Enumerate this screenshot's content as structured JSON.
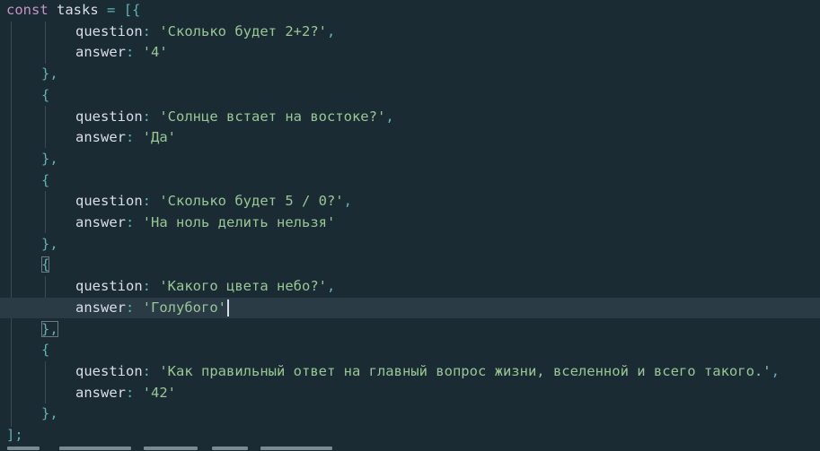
{
  "code": {
    "keyword": "const",
    "var_name": "tasks",
    "assign": "=",
    "open": "[{",
    "close": "];",
    "question_key": "question",
    "answer_key": "answer",
    "obj_open": "{",
    "obj_close": "},",
    "tasks": [
      {
        "question": "'Сколько будет 2+2?'",
        "answer": "'4'"
      },
      {
        "question": "'Солнце встает на востоке?'",
        "answer": "'Да'"
      },
      {
        "question": "'Сколько будет 5 / 0?'",
        "answer": "'На ноль делить нельзя'"
      },
      {
        "question": "'Какого цвета небо?'",
        "answer": "'Голубого'"
      },
      {
        "question": "'Как правильный ответ на главный вопрос жизни, вселенной и всего такого.'",
        "answer": "'42'"
      }
    ]
  },
  "colors": {
    "background": "#1b2b34",
    "current_line": "#2b3b45",
    "keyword": "#c594c5",
    "punctuation": "#5fb3b3",
    "string": "#99c794",
    "text": "#d8dee9"
  }
}
